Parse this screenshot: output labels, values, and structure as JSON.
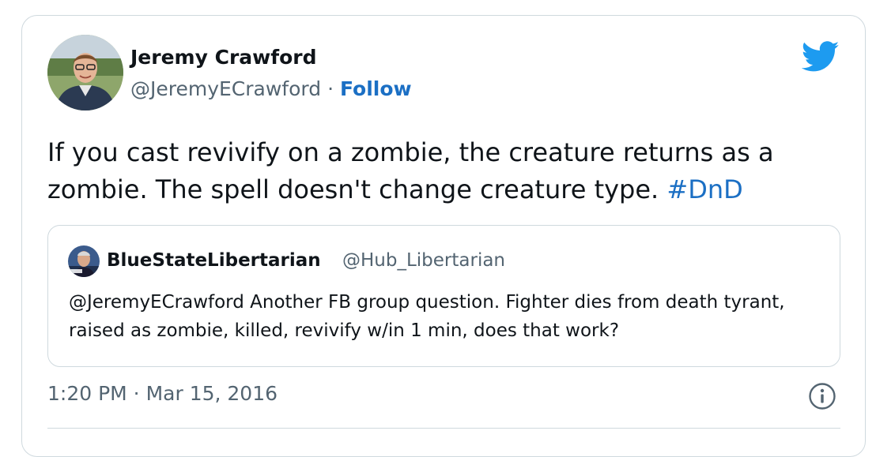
{
  "tweet": {
    "author_name": "Jeremy Crawford",
    "author_handle": "@JeremyECrawford",
    "separator": " · ",
    "follow_label": "Follow",
    "text": "If you cast revivify on a zombie, the creature returns as a zombie. The spell doesn't change creature type. ",
    "hashtag": "#DnD",
    "timestamp": "1:20 PM · Mar 15, 2016",
    "brand_icon": "twitter-bird-icon",
    "info_icon": "info-icon"
  },
  "quote": {
    "author_name": "BlueStateLibertarian",
    "author_handle": "@Hub_Libertarian",
    "text": "@JeremyECrawford Another FB group question. Fighter dies from death tyrant, raised as zombie, killed, revivify w/in 1 min, does that work?"
  },
  "colors": {
    "accent": "#1b6fc4",
    "twitter_blue": "#1d9bf0",
    "secondary_text": "#536471",
    "border": "#cfd9de"
  }
}
